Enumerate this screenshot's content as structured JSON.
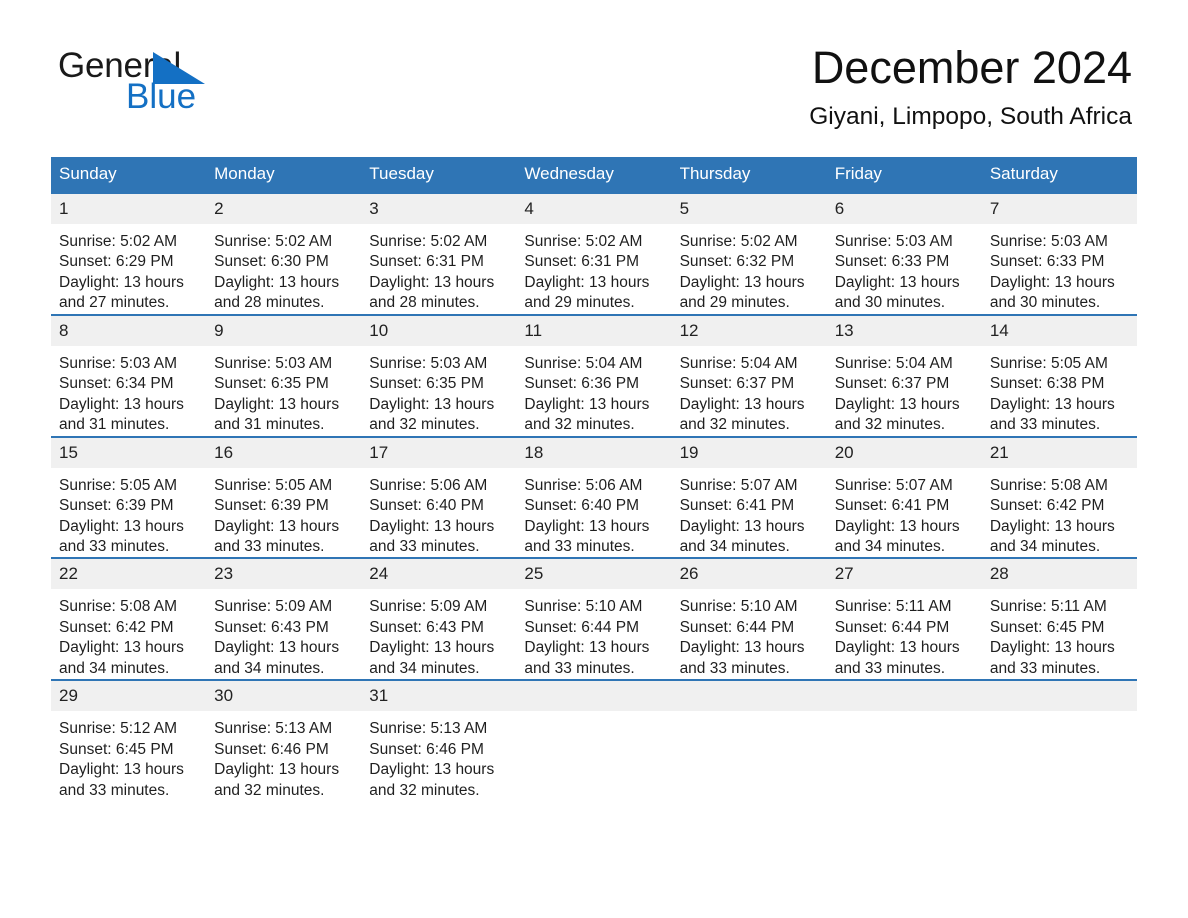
{
  "brand": {
    "name_part1": "General",
    "name_part2": "Blue",
    "triangle_icon": "blue-triangle-icon",
    "accent_color": "#1470c4"
  },
  "header": {
    "title": "December 2024",
    "location": "Giyani, Limpopo, South Africa"
  },
  "theme": {
    "header_blue": "#2f75b5",
    "daynum_gray": "#f0f0f0",
    "text": "#1f1f1f"
  },
  "weekdays": [
    "Sunday",
    "Monday",
    "Tuesday",
    "Wednesday",
    "Thursday",
    "Friday",
    "Saturday"
  ],
  "weeks": [
    [
      {
        "day": "1",
        "sunrise": "Sunrise: 5:02 AM",
        "sunset": "Sunset: 6:29 PM",
        "daylight": "Daylight: 13 hours and 27 minutes."
      },
      {
        "day": "2",
        "sunrise": "Sunrise: 5:02 AM",
        "sunset": "Sunset: 6:30 PM",
        "daylight": "Daylight: 13 hours and 28 minutes."
      },
      {
        "day": "3",
        "sunrise": "Sunrise: 5:02 AM",
        "sunset": "Sunset: 6:31 PM",
        "daylight": "Daylight: 13 hours and 28 minutes."
      },
      {
        "day": "4",
        "sunrise": "Sunrise: 5:02 AM",
        "sunset": "Sunset: 6:31 PM",
        "daylight": "Daylight: 13 hours and 29 minutes."
      },
      {
        "day": "5",
        "sunrise": "Sunrise: 5:02 AM",
        "sunset": "Sunset: 6:32 PM",
        "daylight": "Daylight: 13 hours and 29 minutes."
      },
      {
        "day": "6",
        "sunrise": "Sunrise: 5:03 AM",
        "sunset": "Sunset: 6:33 PM",
        "daylight": "Daylight: 13 hours and 30 minutes."
      },
      {
        "day": "7",
        "sunrise": "Sunrise: 5:03 AM",
        "sunset": "Sunset: 6:33 PM",
        "daylight": "Daylight: 13 hours and 30 minutes."
      }
    ],
    [
      {
        "day": "8",
        "sunrise": "Sunrise: 5:03 AM",
        "sunset": "Sunset: 6:34 PM",
        "daylight": "Daylight: 13 hours and 31 minutes."
      },
      {
        "day": "9",
        "sunrise": "Sunrise: 5:03 AM",
        "sunset": "Sunset: 6:35 PM",
        "daylight": "Daylight: 13 hours and 31 minutes."
      },
      {
        "day": "10",
        "sunrise": "Sunrise: 5:03 AM",
        "sunset": "Sunset: 6:35 PM",
        "daylight": "Daylight: 13 hours and 32 minutes."
      },
      {
        "day": "11",
        "sunrise": "Sunrise: 5:04 AM",
        "sunset": "Sunset: 6:36 PM",
        "daylight": "Daylight: 13 hours and 32 minutes."
      },
      {
        "day": "12",
        "sunrise": "Sunrise: 5:04 AM",
        "sunset": "Sunset: 6:37 PM",
        "daylight": "Daylight: 13 hours and 32 minutes."
      },
      {
        "day": "13",
        "sunrise": "Sunrise: 5:04 AM",
        "sunset": "Sunset: 6:37 PM",
        "daylight": "Daylight: 13 hours and 32 minutes."
      },
      {
        "day": "14",
        "sunrise": "Sunrise: 5:05 AM",
        "sunset": "Sunset: 6:38 PM",
        "daylight": "Daylight: 13 hours and 33 minutes."
      }
    ],
    [
      {
        "day": "15",
        "sunrise": "Sunrise: 5:05 AM",
        "sunset": "Sunset: 6:39 PM",
        "daylight": "Daylight: 13 hours and 33 minutes."
      },
      {
        "day": "16",
        "sunrise": "Sunrise: 5:05 AM",
        "sunset": "Sunset: 6:39 PM",
        "daylight": "Daylight: 13 hours and 33 minutes."
      },
      {
        "day": "17",
        "sunrise": "Sunrise: 5:06 AM",
        "sunset": "Sunset: 6:40 PM",
        "daylight": "Daylight: 13 hours and 33 minutes."
      },
      {
        "day": "18",
        "sunrise": "Sunrise: 5:06 AM",
        "sunset": "Sunset: 6:40 PM",
        "daylight": "Daylight: 13 hours and 33 minutes."
      },
      {
        "day": "19",
        "sunrise": "Sunrise: 5:07 AM",
        "sunset": "Sunset: 6:41 PM",
        "daylight": "Daylight: 13 hours and 34 minutes."
      },
      {
        "day": "20",
        "sunrise": "Sunrise: 5:07 AM",
        "sunset": "Sunset: 6:41 PM",
        "daylight": "Daylight: 13 hours and 34 minutes."
      },
      {
        "day": "21",
        "sunrise": "Sunrise: 5:08 AM",
        "sunset": "Sunset: 6:42 PM",
        "daylight": "Daylight: 13 hours and 34 minutes."
      }
    ],
    [
      {
        "day": "22",
        "sunrise": "Sunrise: 5:08 AM",
        "sunset": "Sunset: 6:42 PM",
        "daylight": "Daylight: 13 hours and 34 minutes."
      },
      {
        "day": "23",
        "sunrise": "Sunrise: 5:09 AM",
        "sunset": "Sunset: 6:43 PM",
        "daylight": "Daylight: 13 hours and 34 minutes."
      },
      {
        "day": "24",
        "sunrise": "Sunrise: 5:09 AM",
        "sunset": "Sunset: 6:43 PM",
        "daylight": "Daylight: 13 hours and 34 minutes."
      },
      {
        "day": "25",
        "sunrise": "Sunrise: 5:10 AM",
        "sunset": "Sunset: 6:44 PM",
        "daylight": "Daylight: 13 hours and 33 minutes."
      },
      {
        "day": "26",
        "sunrise": "Sunrise: 5:10 AM",
        "sunset": "Sunset: 6:44 PM",
        "daylight": "Daylight: 13 hours and 33 minutes."
      },
      {
        "day": "27",
        "sunrise": "Sunrise: 5:11 AM",
        "sunset": "Sunset: 6:44 PM",
        "daylight": "Daylight: 13 hours and 33 minutes."
      },
      {
        "day": "28",
        "sunrise": "Sunrise: 5:11 AM",
        "sunset": "Sunset: 6:45 PM",
        "daylight": "Daylight: 13 hours and 33 minutes."
      }
    ],
    [
      {
        "day": "29",
        "sunrise": "Sunrise: 5:12 AM",
        "sunset": "Sunset: 6:45 PM",
        "daylight": "Daylight: 13 hours and 33 minutes."
      },
      {
        "day": "30",
        "sunrise": "Sunrise: 5:13 AM",
        "sunset": "Sunset: 6:46 PM",
        "daylight": "Daylight: 13 hours and 32 minutes."
      },
      {
        "day": "31",
        "sunrise": "Sunrise: 5:13 AM",
        "sunset": "Sunset: 6:46 PM",
        "daylight": "Daylight: 13 hours and 32 minutes."
      },
      {
        "day": "",
        "sunrise": "",
        "sunset": "",
        "daylight": ""
      },
      {
        "day": "",
        "sunrise": "",
        "sunset": "",
        "daylight": ""
      },
      {
        "day": "",
        "sunrise": "",
        "sunset": "",
        "daylight": ""
      },
      {
        "day": "",
        "sunrise": "",
        "sunset": "",
        "daylight": ""
      }
    ]
  ]
}
